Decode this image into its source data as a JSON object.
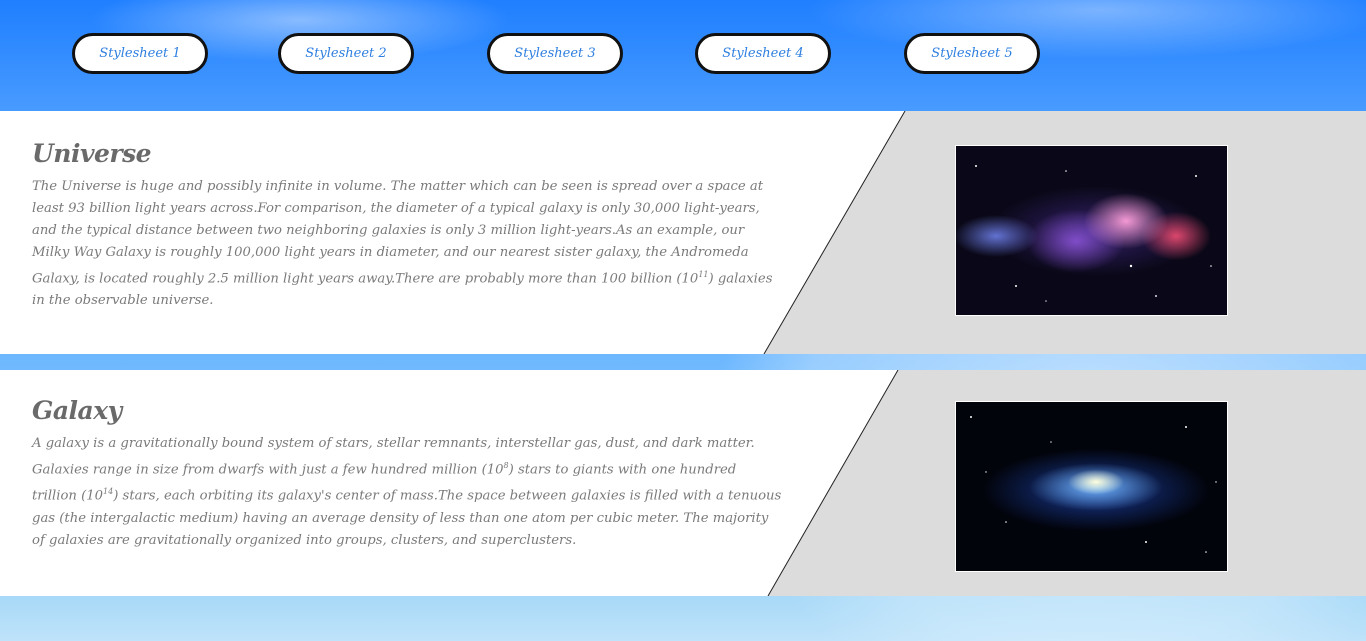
{
  "nav": {
    "buttons": [
      "Stylesheet 1",
      "Stylesheet 2",
      "Stylesheet 3",
      "Stylesheet 4",
      "Stylesheet 5"
    ]
  },
  "sections": [
    {
      "title": "Universe",
      "text": [
        "The Universe is huge and possibly infinite in volume. The matter which can be seen is spread over a space at least 93 billion light years across.For comparison, the diameter of a typical galaxy is only 30,000 light-years, and the typical distance between two neighboring galaxies is only 3 million light-years.As an example, our Milky Way Galaxy is roughly 100,000 light years in diameter, and our nearest sister galaxy, the Andromeda Galaxy, is located roughly 2.5 million light years away.There are probably more than 100 billion (10",
        "11",
        ") galaxies in the observable universe."
      ],
      "image": "nebula-image"
    },
    {
      "title": "Galaxy",
      "text": [
        "A galaxy is a gravitationally bound system of stars, stellar remnants, interstellar gas, dust, and dark matter. Galaxies range in size from dwarfs with just a few hundred million (10",
        "8",
        ") stars to giants with one hundred trillion (10",
        "14",
        ") stars, each orbiting its galaxy's center of mass.The space between galaxies is filled with a tenuous gas (the intergalactic medium) having an average density of less than one atom per cubic meter. The majority of galaxies are gravitationally organized into groups, clusters, and superclusters."
      ],
      "image": "spiral-galaxy-image"
    }
  ],
  "colors": {
    "accent": "#2f7fe0",
    "panel_gray": "#dcdcdc",
    "text_gray": "#7a7a7a"
  }
}
